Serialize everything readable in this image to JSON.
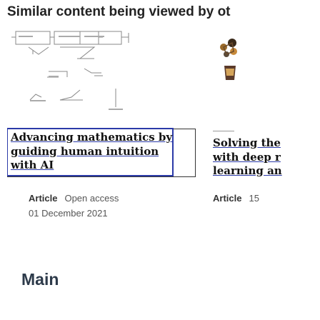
{
  "section": {
    "title": "Similar content being viewed by ot"
  },
  "cards": [
    {
      "title": "Advancing mathematics by\nguiding human intuition\nwith AI",
      "type": "Article",
      "access": "Open access",
      "date": "01 December 2021"
    },
    {
      "title": "Solving the\nwith deep r\nlearning an",
      "type": "Article",
      "count": "15"
    }
  ],
  "next_section": {
    "title": "Main"
  },
  "colors": {
    "link_underline": "#2b3aa8",
    "frame": "#2b3aa8",
    "text": "#222222"
  },
  "icons": [
    "network-diagram",
    "molecule-icon",
    "glass-icon"
  ]
}
